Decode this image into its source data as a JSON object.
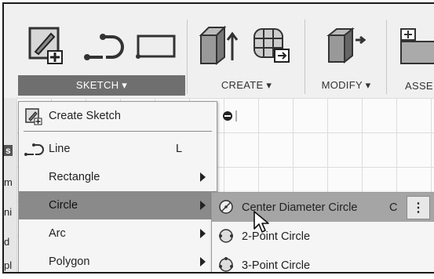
{
  "toolbar": {
    "groups": [
      {
        "label": "SKETCH ▾"
      },
      {
        "label": "CREATE ▾"
      },
      {
        "label": "MODIFY ▾"
      },
      {
        "label": "ASSE"
      }
    ]
  },
  "left_strip": [
    "s",
    "m",
    "ni",
    "d",
    "pl"
  ],
  "sketch_menu": {
    "items": [
      {
        "label": "Create Sketch",
        "shortcut": "",
        "icon": "create-sketch-icon"
      },
      {
        "label": "Line",
        "shortcut": "L",
        "icon": "line-icon"
      },
      {
        "label": "Rectangle",
        "shortcut": ""
      },
      {
        "label": "Circle",
        "shortcut": ""
      },
      {
        "label": "Arc",
        "shortcut": ""
      },
      {
        "label": "Polygon",
        "shortcut": ""
      }
    ]
  },
  "circle_submenu": {
    "items": [
      {
        "label": "Center Diameter Circle",
        "shortcut": "C",
        "icon": "center-diameter-circle-icon"
      },
      {
        "label": "2-Point Circle",
        "shortcut": "",
        "icon": "two-point-circle-icon"
      },
      {
        "label": "3-Point Circle",
        "shortcut": "",
        "icon": "three-point-circle-icon"
      }
    ],
    "more_label": "⋮"
  }
}
